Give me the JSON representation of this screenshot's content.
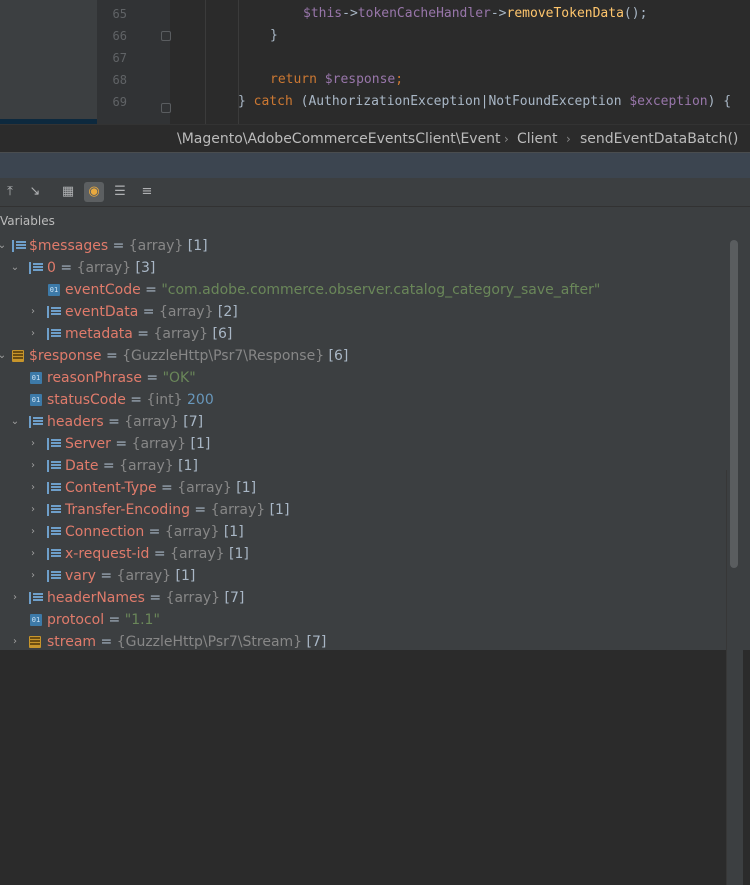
{
  "editor": {
    "lines": [
      {
        "num": "65"
      },
      {
        "num": "66"
      },
      {
        "num": "67"
      },
      {
        "num": "68"
      },
      {
        "num": "69"
      }
    ],
    "code": {
      "l65": {
        "a": "$this",
        "b": "->",
        "c": "tokenCacheHandler",
        "d": "->",
        "e": "removeTokenData",
        "f": "();"
      },
      "l66": {
        "a": "}"
      },
      "l68": {
        "kw": "return",
        "var": "$response",
        "end": ";"
      },
      "l69": {
        "a": "} ",
        "kw": "catch",
        "b": " (AuthorizationException|NotFoundException ",
        "var": "$exception",
        "c": ") {"
      }
    }
  },
  "breadcrumb": {
    "items": [
      "\\Magento\\AdobeCommerceEventsClient\\Event",
      "Client",
      "sendEventDataBatch()"
    ],
    "separator": "›"
  },
  "toolbar": {
    "icons": [
      "step-out-icon",
      "run-to-cursor-icon",
      "evaluate-icon",
      "watch-icon",
      "list-icon",
      "add-watch-icon"
    ]
  },
  "variables": {
    "label": "Variables",
    "rows": [
      {
        "name": "$messages",
        "eq": " = ",
        "type": "{array}",
        "val": " [1]",
        "icon": "array"
      },
      {
        "name": "0",
        "eq": " = ",
        "type": "{array}",
        "val": " [3]",
        "icon": "array"
      },
      {
        "name": "eventCode",
        "eq": " = ",
        "str": "\"com.adobe.commerce.observer.catalog_category_save_after\"",
        "icon": "field"
      },
      {
        "name": "eventData",
        "eq": " = ",
        "type": "{array}",
        "val": " [2]",
        "icon": "array"
      },
      {
        "name": "metadata",
        "eq": " = ",
        "type": "{array}",
        "val": " [6]",
        "icon": "array"
      },
      {
        "name": "$response",
        "eq": " = ",
        "type": "{GuzzleHttp\\Psr7\\Response}",
        "val": " [6]",
        "icon": "object"
      },
      {
        "name": "reasonPhrase",
        "eq": " = ",
        "str": "\"OK\"",
        "icon": "field"
      },
      {
        "name": "statusCode",
        "eq": " = ",
        "type": "{int}",
        "num": " 200",
        "icon": "field"
      },
      {
        "name": "headers",
        "eq": " = ",
        "type": "{array}",
        "val": " [7]",
        "icon": "array"
      },
      {
        "name": "Server",
        "eq": " = ",
        "type": "{array}",
        "val": " [1]",
        "icon": "array"
      },
      {
        "name": "Date",
        "eq": " = ",
        "type": "{array}",
        "val": " [1]",
        "icon": "array"
      },
      {
        "name": "Content-Type",
        "eq": " = ",
        "type": "{array}",
        "val": " [1]",
        "icon": "array"
      },
      {
        "name": "Transfer-Encoding",
        "eq": " = ",
        "type": "{array}",
        "val": " [1]",
        "icon": "array"
      },
      {
        "name": "Connection",
        "eq": " = ",
        "type": "{array}",
        "val": " [1]",
        "icon": "array"
      },
      {
        "name": "x-request-id",
        "eq": " = ",
        "type": "{array}",
        "val": " [1]",
        "icon": "array"
      },
      {
        "name": "vary",
        "eq": " = ",
        "type": "{array}",
        "val": " [1]",
        "icon": "array"
      },
      {
        "name": "headerNames",
        "eq": " = ",
        "type": "{array}",
        "val": " [7]",
        "icon": "array"
      },
      {
        "name": "protocol",
        "eq": " = ",
        "str": "\"1.1\"",
        "icon": "field"
      },
      {
        "name": "stream",
        "eq": " = ",
        "type": "{GuzzleHttp\\Psr7\\Stream}",
        "val": " [7]",
        "icon": "object"
      }
    ]
  },
  "colors": {
    "name": "#e07b6b",
    "string": "#6a8759",
    "number": "#6897bb",
    "keyword": "#cc7832",
    "variable": "#9876aa",
    "function": "#ffc66d"
  }
}
